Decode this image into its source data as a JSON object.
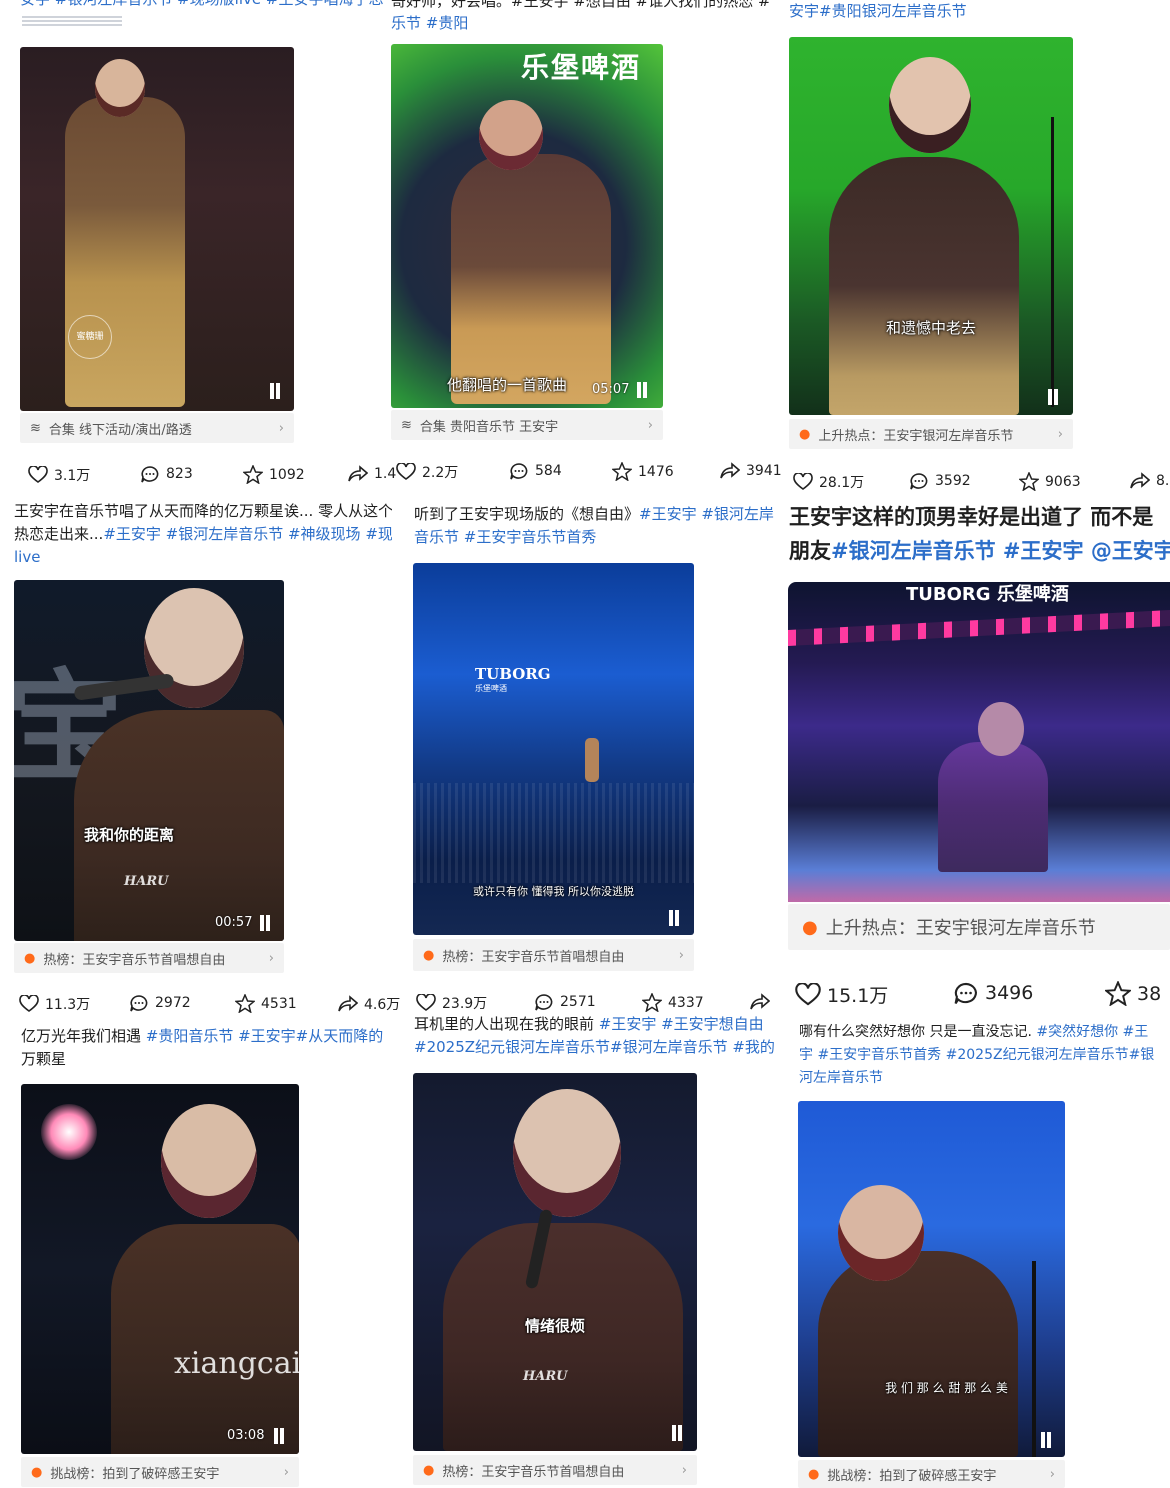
{
  "top_partial": {
    "c1": "安宇 #银河左岸音乐节 #现场版live #王安宇唱海子忘",
    "c2a": "哥好帅，好会唱。#王安宇 #想自由 #谁人找们的热恋 #",
    "c2b": "乐节 #贵阳",
    "c3": "安宇#贵阳银河左岸音乐节"
  },
  "cards": [
    {
      "video": {
        "subtitle": "",
        "time": "",
        "watermark": "蜜糖珊"
      },
      "pill": {
        "icon": "layers-icon",
        "text": "合集  线下活动/演出/路透"
      },
      "stats": {
        "likes": "3.1万",
        "comments": "823",
        "stars": "1092",
        "shares": "1.4"
      }
    },
    {
      "video": {
        "subtitle": "他翻唱的一首歌曲",
        "time": "05:07",
        "banner": "乐堡啤酒"
      },
      "pill": {
        "icon": "layers-icon",
        "text": "合集  贵阳音乐节 王安宇"
      },
      "stats": {
        "likes": "2.2万",
        "comments": "584",
        "stars": "1476",
        "shares": "3941"
      }
    },
    {
      "video": {
        "subtitle": "和遗憾中老去",
        "time": ""
      },
      "pill": {
        "icon": "flame-icon",
        "text": "上升热点：王安宇银河左岸音乐节"
      },
      "stats": {
        "likes": "28.1万",
        "comments": "3592",
        "stars": "9063",
        "shares": "8."
      }
    },
    {
      "caption": [
        {
          "t": "王安宇在音乐节唱了从天而降的亿万颗星诶... 零人从这个",
          "tag": false
        },
        {
          "t": "热恋走出来...",
          "tag": false
        },
        {
          "t": "#王安宇 #银河左岸音乐节 #神级现场 #现场",
          "tag": true
        },
        {
          "t": "live",
          "tag": true
        }
      ],
      "video": {
        "subtitle": "我和你的距离",
        "time": "00:57",
        "watermark": "HARU"
      },
      "pill": {
        "icon": "flame-icon",
        "text": "热榜：王安宇音乐节首唱想自由"
      },
      "stats": {
        "likes": "11.3万",
        "comments": "2972",
        "stars": "4531",
        "shares": "4.6万"
      }
    },
    {
      "caption_plain": "听到了王安宇现场版的《想自由》",
      "caption_tags": "#王安宇 #银河左岸音乐节 #王安宇音乐节首秀",
      "video": {
        "subtitle": "或许只有你  懂得我  所以你没逃脱",
        "banner": "TUBORG",
        "banner2": "乐堡啤酒"
      },
      "pill": {
        "icon": "flame-icon",
        "text": "热榜：王安宇音乐节首唱想自由"
      },
      "stats": {
        "likes": "23.9万",
        "comments": "2571",
        "stars": "4337",
        "shares": ""
      }
    },
    {
      "caption_plain": "王安宇这样的顶男幸好是出道了 而不是",
      "caption_plain2": "朋友",
      "caption_tags": "#银河左岸音乐节 #王安宇 @王安宇",
      "video": {
        "banner": "TUBORG 乐堡啤酒"
      },
      "pill": {
        "icon": "flame-icon",
        "text": "上升热点：王安宇银河左岸音乐节"
      },
      "stats": {
        "likes": "15.1万",
        "comments": "3496",
        "stars": "38"
      }
    },
    {
      "caption_plain": "亿万光年我们相遇 ",
      "caption_tags": "#贵阳音乐节 #王安宇#从天而降的",
      "caption_tags2": "万颗星",
      "video": {
        "time": "03:08",
        "watermark": "xiangcai"
      },
      "pill": {
        "icon": "flame-icon",
        "text": "挑战榜：拍到了破碎感王安宇"
      }
    },
    {
      "caption_plain": "耳机里的人出现在我的眼前 ",
      "caption_tags": "#王安宇 #王安宇想自由",
      "caption_tags2": "#2025Z纪元银河左岸音乐节#银河左岸音乐节 #我的",
      "video": {
        "subtitle": "情绪很烦",
        "watermark": "HARU"
      },
      "pill": {
        "icon": "flame-icon",
        "text": "热榜：王安宇音乐节首唱想自由"
      }
    },
    {
      "caption_plain": "哪有什么突然好想你 只是一直没忘记. ",
      "caption_tags": "#突然好想你 #王",
      "caption_tags2": "宇 #王安宇音乐节首秀 #2025Z纪元银河左岸音乐节#银",
      "caption_tags3": "河左岸音乐节",
      "video": {
        "subtitle": "我 们 那 么 甜 那 么 美"
      },
      "pill": {
        "icon": "flame-icon",
        "text": "挑战榜：拍到了破碎感王安宇"
      }
    }
  ]
}
